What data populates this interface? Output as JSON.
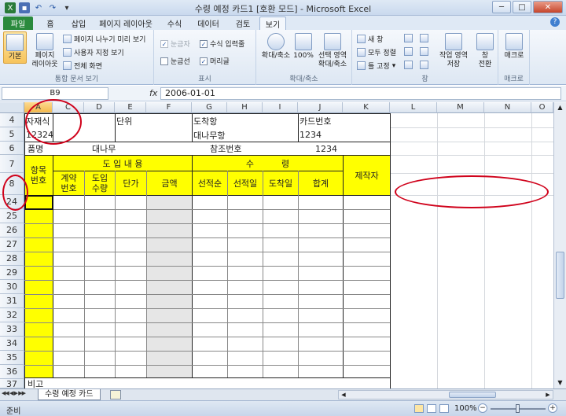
{
  "window": {
    "title": "수령 예정 카드1  [호환 모드] - Microsoft Excel",
    "min_label": "─",
    "max_label": "□",
    "close_label": "✕"
  },
  "tabs": [
    "파일",
    "홈",
    "삽입",
    "페이지 레이아웃",
    "수식",
    "데이터",
    "검토",
    "보기"
  ],
  "ribbon": {
    "workbook_views": {
      "label": "통합 문서 보기",
      "normal": "기본",
      "page_layout": "페이지\n레이아웃",
      "page_break": "페이지 나누기 미리 보기",
      "custom_views": "사용자 지정 보기",
      "full_screen": "전체 화면"
    },
    "show": {
      "label": "표시",
      "ruler": "눈금자",
      "gridlines": "눈금선",
      "formula_bar": "수식 입력줄",
      "headings": "머리글"
    },
    "zoom": {
      "label": "확대/축소",
      "zoom": "확대/축소",
      "hundred": "100%",
      "zoom_selection": "선택 영역\n확대/축소"
    },
    "window": {
      "label": "창",
      "new_window": "새 창",
      "arrange_all": "모두 정렬",
      "freeze": "틀 고정",
      "save_workspace": "작업 영역\n저장",
      "switch_windows": "창\n전환"
    },
    "macros": {
      "label": "매크로",
      "macros": "매크로"
    }
  },
  "formula_bar": {
    "name_box": "B9",
    "fx": "fx",
    "value": "2006-01-01"
  },
  "columns": [
    "A",
    "C",
    "D",
    "E",
    "F",
    "G",
    "H",
    "I",
    "J",
    "K",
    "L",
    "M",
    "N",
    "O"
  ],
  "rows": [
    "4",
    "5",
    "6",
    "7",
    "8",
    "24",
    "25",
    "26",
    "27",
    "28",
    "29",
    "30",
    "31",
    "32",
    "33",
    "34",
    "35",
    "36",
    "37"
  ],
  "sheet": {
    "r4_a": "자재식",
    "r4_e": "단위",
    "r4_g": "도착항",
    "r4_j": "카드번호",
    "r5_a": "12324",
    "r5_g": "대나무항",
    "r5_j": "1234",
    "r6_a": "품명",
    "r6_d": "대나무",
    "r6_g": "참조번호",
    "r6_j": "1234",
    "hdr_item": "항목\n번호",
    "hdr_import": "도  입  내  용",
    "hdr_qty": "수          령",
    "hdr_maker": "제작자",
    "hdr_contract": "계약\n번호",
    "hdr_import_qty": "도입\n수량",
    "hdr_unit_price": "단가",
    "hdr_amount": "금액",
    "hdr_ship_order": "선적순",
    "hdr_ship_date": "선적일",
    "hdr_arrival": "도착일",
    "hdr_total": "합계",
    "r37_a": "비고"
  },
  "sheet_tab": {
    "name": "수령 예정 카드",
    "nav": "◀◀ ◀ ▶ ▶▶"
  },
  "status": {
    "ready": "준비",
    "zoom": "100%"
  },
  "colors": {
    "yellow": "#ffff00",
    "annotation": "#d0021b",
    "file_tab": "#2a8a3d"
  }
}
